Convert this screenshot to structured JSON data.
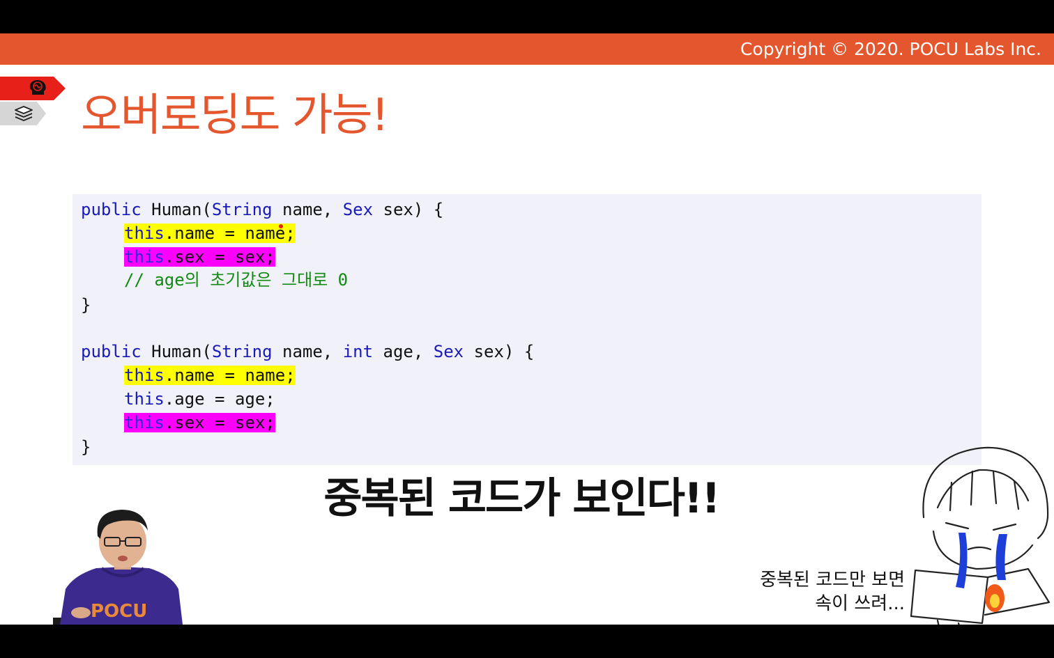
{
  "header": {
    "copyright": "Copyright © 2020. POCU Labs Inc."
  },
  "nav_icons": [
    "brain-icon",
    "books-icon"
  ],
  "slide": {
    "title": "오버로딩도 가능!"
  },
  "code": {
    "block1": {
      "l1_kw1": "public",
      "l1_a": " Human(",
      "l1_kw2": "String",
      "l1_b": " name, ",
      "l1_kw3": "Sex",
      "l1_c": " sex) {",
      "l2_kw": "this",
      "l2_rest": ".name = name;",
      "l3_kw": "this",
      "l3_rest": ".sex = sex;",
      "l4_comment": "// age의 초기값은 그대로 0",
      "l5_close": "}"
    },
    "block2": {
      "l1_kw1": "public",
      "l1_a": " Human(",
      "l1_kw2": "String",
      "l1_b": " name, ",
      "l1_kw3": "int",
      "l1_c": " age, ",
      "l1_kw4": "Sex",
      "l1_d": " sex) {",
      "l2_kw": "this",
      "l2_rest": ".name = name;",
      "l3_kw": "this",
      "l3_rest": ".age = age;",
      "l4_kw": "this",
      "l4_rest": ".sex = sex;",
      "l5_close": "}"
    }
  },
  "captions": {
    "main": "중복된 코드가 보인다!!",
    "side_line1": "중복된 코드만 보면",
    "side_line2": "속이 쓰려..."
  },
  "presenter": {
    "shirt_text": "POCU"
  },
  "colors": {
    "accent": "#e4572e",
    "tab_red": "#e8201a",
    "code_bg": "#f1f1f9",
    "keyword": "#1a1ab8",
    "comment": "#118a11",
    "highlight_yellow": "#ffff00",
    "highlight_magenta": "#ff00ff"
  }
}
